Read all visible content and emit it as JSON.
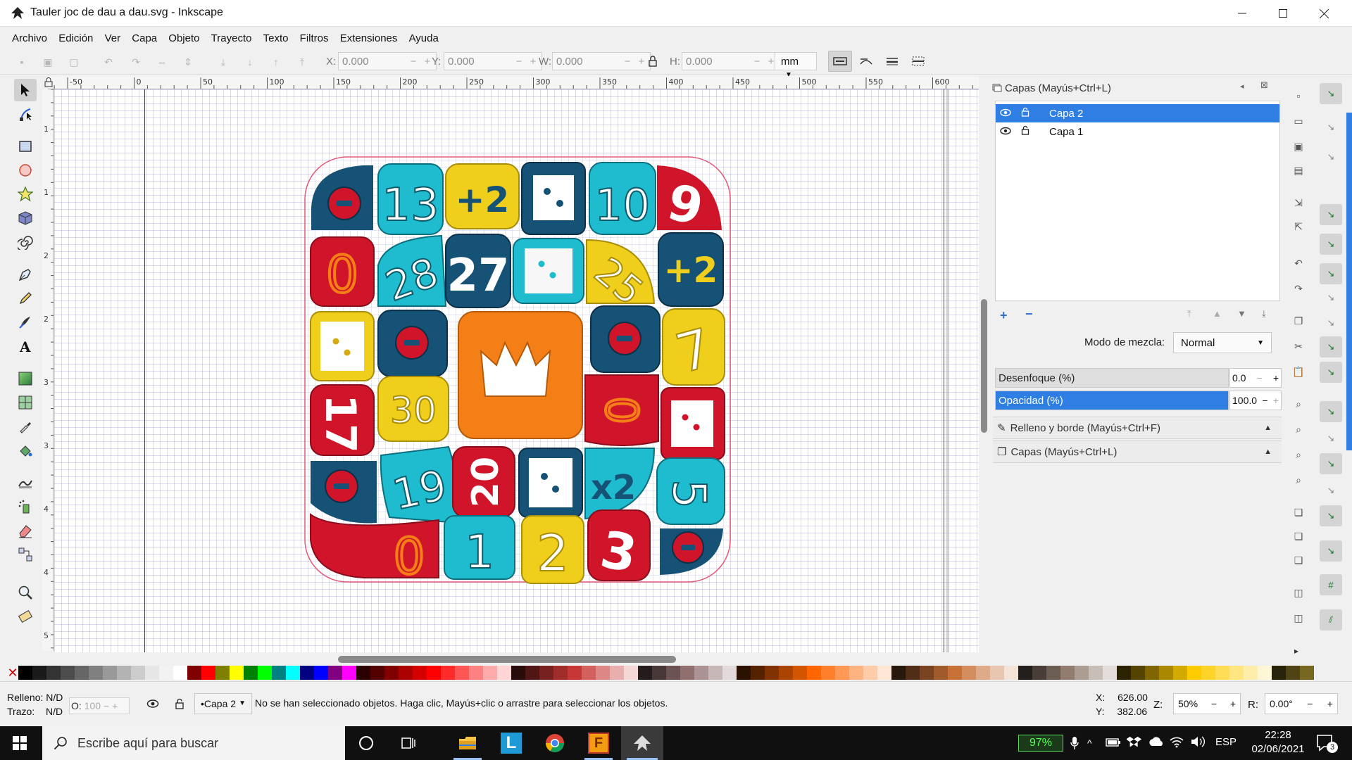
{
  "window": {
    "title": "Tauler joc de dau a dau.svg - Inkscape",
    "min_icon": "minimize-icon",
    "max_icon": "maximize-icon",
    "close_icon": "close-icon"
  },
  "menu": [
    "Archivo",
    "Edición",
    "Ver",
    "Capa",
    "Objeto",
    "Trayecto",
    "Texto",
    "Filtros",
    "Extensiones",
    "Ayuda"
  ],
  "toolbar": {
    "x_label": "X:",
    "x_value": "0.000",
    "y_label": "Y:",
    "y_value": "0.000",
    "w_label": "W:",
    "w_value": "0.000",
    "h_label": "H:",
    "h_value": "0.000",
    "units": "mm"
  },
  "ruler_h_labels": [
    "-50",
    "0",
    "50",
    "100",
    "150",
    "200",
    "250",
    "300",
    "350",
    "400",
    "450",
    "500",
    "550",
    "600"
  ],
  "ruler_v_labels": [
    "1",
    "1",
    "2",
    "2",
    "3",
    "3",
    "4",
    "4",
    "5"
  ],
  "board": {
    "tiles": [
      {
        "text": "13"
      },
      {
        "text": "+2"
      },
      {
        "text": "10"
      },
      {
        "text": "9"
      },
      {
        "text": "0"
      },
      {
        "text": "28"
      },
      {
        "text": "27"
      },
      {
        "text": "25"
      },
      {
        "text": "+2"
      },
      {
        "text": "7"
      },
      {
        "text": "17"
      },
      {
        "text": "30"
      },
      {
        "text": "0"
      },
      {
        "text": "19"
      },
      {
        "text": "20"
      },
      {
        "text": "x2"
      },
      {
        "text": "5"
      },
      {
        "text": "0"
      },
      {
        "text": "1"
      },
      {
        "text": "2"
      },
      {
        "text": "3"
      }
    ]
  },
  "layers_panel": {
    "title": "Capas (Mayús+Ctrl+L)",
    "layers": [
      {
        "name": "Capa 2",
        "selected": true
      },
      {
        "name": "Capa 1",
        "selected": false
      }
    ],
    "blend_label": "Modo de mezcla:",
    "blend_value": "Normal",
    "blur_label": "Desenfoque (%)",
    "blur_value": "0.0",
    "opacity_label": "Opacidad (%)",
    "opacity_value": "100.0",
    "opacity_fraction": 1.0,
    "fill_stroke_tab": "Relleno y borde (Mayús+Ctrl+F)",
    "layers_tab": "Capas (Mayús+Ctrl+L)"
  },
  "status": {
    "fill_label": "Relleno:",
    "fill_value": "N/D",
    "stroke_label": "Trazo:",
    "stroke_value": "N/D",
    "opacity_label": "O:",
    "opacity_value": "100",
    "layer": "•Capa 2",
    "message": "No se han seleccionado objetos. Haga clic, Mayús+clic o arrastre para seleccionar los objetos.",
    "x_label": "X:",
    "x_value": "626.00",
    "y_label": "Y:",
    "y_value": "382.06",
    "zoom_label": "Z:",
    "zoom_value": "50%",
    "rot_label": "R:",
    "rot_value": "0.00°"
  },
  "taskbar": {
    "search_placeholder": "Escribe aquí para buscar",
    "battery": "97%",
    "lang": "ESP",
    "time": "22:28",
    "date": "02/06/2021",
    "notifications": "3"
  },
  "colors": {
    "accent": "#2f7ee3",
    "tile_red": "#d0152a",
    "tile_teal": "#1fbcd0",
    "tile_yellow": "#f0cf1c",
    "tile_navy": "#165275",
    "tile_orange": "#f57f17"
  }
}
